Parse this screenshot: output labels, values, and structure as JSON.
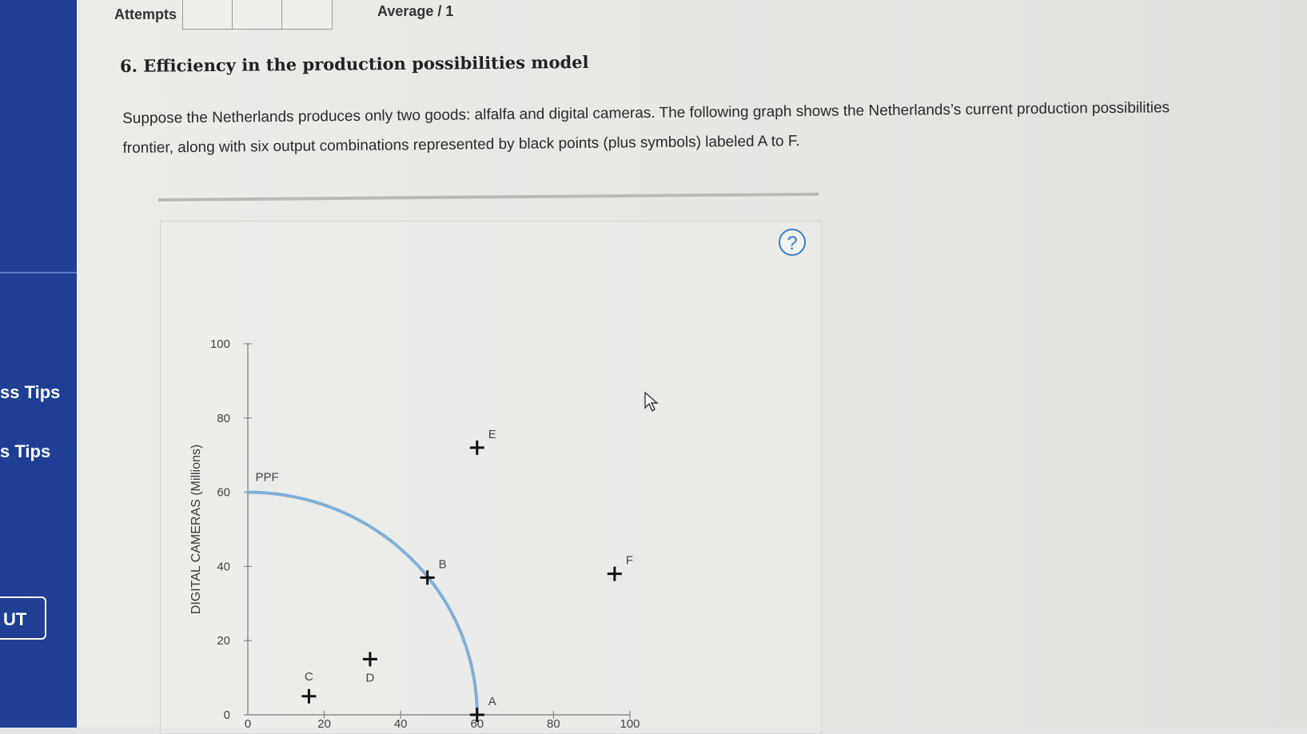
{
  "header": {
    "attempts_label": "Attempts",
    "average_label": "Average / 1"
  },
  "sidebar": {
    "items": [
      {
        "label": "ss Tips"
      },
      {
        "label": "s Tips"
      }
    ],
    "button_label": "UT"
  },
  "question": {
    "title": "6. Efficiency in the production possibilities model",
    "text": "Suppose the Netherlands produces only two goods: alfalfa and digital cameras. The following graph shows the Netherlands’s current production possibilities frontier, along with six output combinations represented by black points (plus symbols) labeled A to F."
  },
  "help": {
    "icon": "question-mark-icon",
    "glyph": "?"
  },
  "colors": {
    "sidebar": "#1f3f95",
    "ppf_curve": "#7fb0d8",
    "help_icon": "#3b7ec8"
  },
  "chart_data": {
    "type": "scatter",
    "ylabel": "DIGITAL CAMERAS (Millions)",
    "xlabel": "",
    "xlim": [
      0,
      100
    ],
    "ylim": [
      0,
      100
    ],
    "x_ticks": [
      "0",
      "20",
      "40",
      "60",
      "80",
      "100"
    ],
    "y_ticks": [
      "0",
      "20",
      "40",
      "60",
      "80",
      "100"
    ],
    "curve": {
      "name": "PPF",
      "x_intercept": 60,
      "y_intercept": 60,
      "passes_through": [
        45,
        40
      ]
    },
    "points": [
      {
        "label": "A",
        "x": 60,
        "y": 0
      },
      {
        "label": "B",
        "x": 47,
        "y": 37
      },
      {
        "label": "C",
        "x": 16,
        "y": 5
      },
      {
        "label": "D",
        "x": 32,
        "y": 15
      },
      {
        "label": "E",
        "x": 60,
        "y": 72
      },
      {
        "label": "F",
        "x": 96,
        "y": 38
      }
    ]
  }
}
